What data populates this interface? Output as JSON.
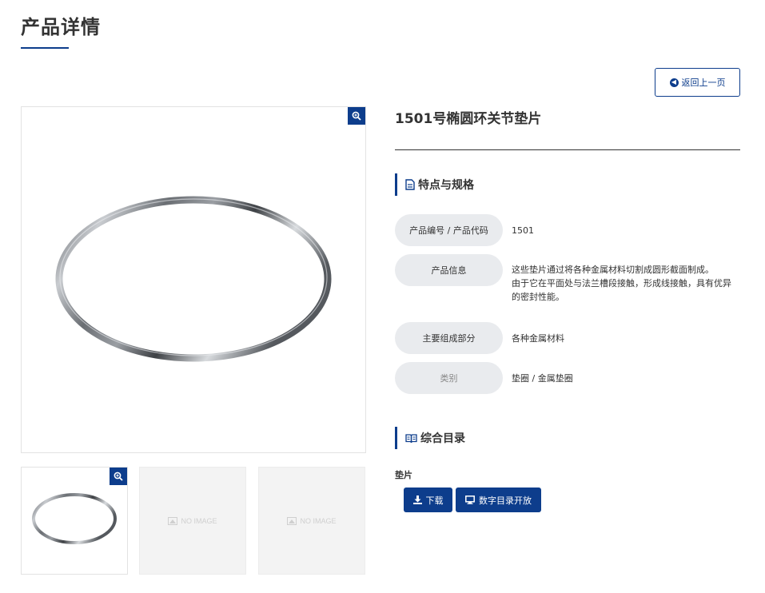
{
  "page_title": "产品详情",
  "back_button": {
    "label": "返回上一页",
    "icon": "arrow-left-circle-icon"
  },
  "product": {
    "title": "1501号椭圆环关节垫片"
  },
  "images": {
    "main": "ring-gasket-photo",
    "thumbnails": [
      {
        "type": "image",
        "label": ""
      },
      {
        "type": "placeholder",
        "label": "NO IMAGE"
      },
      {
        "type": "placeholder",
        "label": "NO IMAGE"
      }
    ]
  },
  "specs": {
    "heading": "特点与规格",
    "heading_icon": "document-icon",
    "rows": [
      {
        "label": "产品编号 / 产品代码",
        "value": "1501"
      },
      {
        "label": "产品信息",
        "value_lines": [
          "这些垫片通过将各种金属材料切割成圆形截面制成。",
          "由于它在平面处与法兰槽段接触，形成线接触，具有优异",
          "的密封性能。"
        ]
      },
      {
        "label": "主要组成部分",
        "value": "各种金属材料"
      },
      {
        "label": "类别",
        "value": "垫圈 / 金属垫圈"
      }
    ]
  },
  "catalog": {
    "heading": "综合目录",
    "heading_icon": "book-icon",
    "item_label": "垫片",
    "download_label": "下载",
    "digital_label": "数字目录开放"
  },
  "colors": {
    "accent": "#0d3d8c",
    "label_bg": "#e9ebee"
  }
}
